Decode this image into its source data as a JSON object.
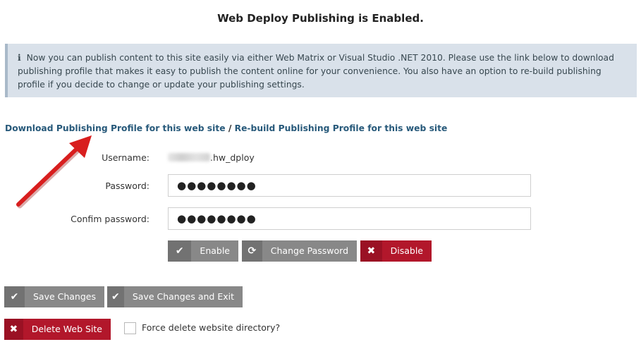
{
  "header": {
    "title": "Web Deploy Publishing is Enabled."
  },
  "info": {
    "icon": "info-icon",
    "text": "Now you can publish content to this site easily via either Web Matrix or Visual Studio .NET 2010. Please use the link below to download publishing profile that makes it easy to publish the content online for your convenience. You also have an option to re-build publishing profile if you decide to change or update your publishing settings."
  },
  "links": {
    "download": "Download Publishing Profile for this web site",
    "separator": "/",
    "rebuild": "Re-build Publishing Profile for this web site"
  },
  "form": {
    "username_label": "Username:",
    "username_value": ".hw_dploy",
    "password_label": "Password:",
    "password_value": "●●●●●●●●",
    "confirm_label": "Confim password:",
    "confirm_value": "●●●●●●●●"
  },
  "buttons": {
    "enable": "Enable",
    "change_password": "Change Password",
    "disable": "Disable",
    "save_changes": "Save Changes",
    "save_exit": "Save Changes and Exit",
    "delete_site": "Delete Web Site"
  },
  "force_delete": {
    "label": "Force delete website directory?",
    "checked": false
  },
  "colors": {
    "link": "#27597a",
    "danger": "#b2172b",
    "neutral": "#888888",
    "info_bg": "#d9e1ea",
    "annotation": "#d81e1e"
  }
}
